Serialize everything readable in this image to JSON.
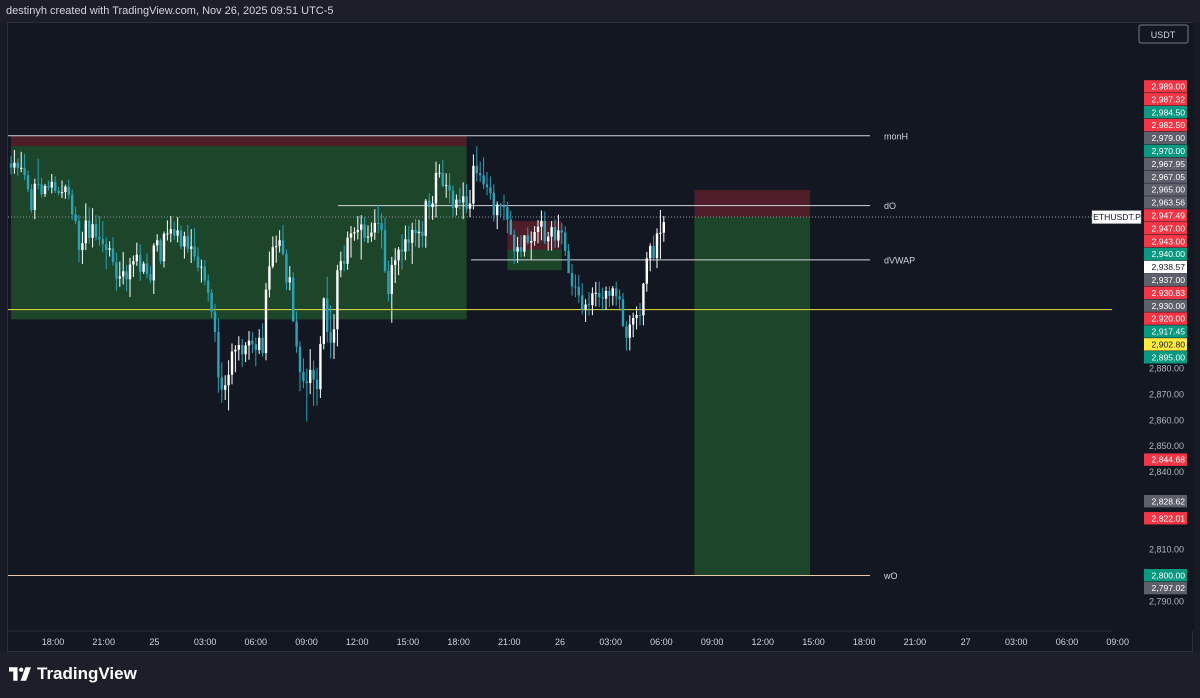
{
  "header": {
    "text": "destinyh created with TradingView.com, Nov 26, 2025 09:51 UTC-5"
  },
  "footer": {
    "brand": "TradingView",
    "logo_icon": "tradingview-logo-icon"
  },
  "colors": {
    "background": "#131722",
    "bull_candle": "#ffffff",
    "bear_candle": "#26a5b8",
    "profit_zone": "#1f4d2b",
    "loss_zone": "#5a1e28",
    "label_red": "#f23645",
    "label_green": "#089981",
    "label_gray": "#5d606b",
    "label_yellow": "#ffeb3b",
    "yellow_line": "#e8e23a",
    "white_line": "#d1d4dc",
    "wo_line": "#e8c9a8",
    "grid_text": "#b2b5be"
  },
  "chart_data": {
    "type": "candlestick",
    "symbol": "ETHUSDT.P",
    "last_price": "2,938.57",
    "currency": "USDT",
    "ylim": [
      2782,
      3002
    ],
    "x_ticks": [
      "18:00",
      "21:00",
      "25",
      "03:00",
      "06:00",
      "09:00",
      "12:00",
      "15:00",
      "18:00",
      "21:00",
      "26",
      "03:00",
      "06:00",
      "09:00",
      "12:00",
      "15:00",
      "18:00",
      "21:00",
      "27",
      "03:00",
      "06:00",
      "09:00"
    ],
    "y_ticks": [
      "2,790.00",
      "2,810.00",
      "2,840.00",
      "2,850.00",
      "2,860.00",
      "2,870.00",
      "2,880.00",
      "2,890.00"
    ],
    "price_labels": [
      {
        "text": "2,989.00",
        "style": "red"
      },
      {
        "text": "2,987.32",
        "style": "red"
      },
      {
        "text": "2,984.50",
        "style": "green"
      },
      {
        "text": "2,982.50",
        "style": "red"
      },
      {
        "text": "2,979.00",
        "style": "gray"
      },
      {
        "text": "2,970.00",
        "style": "green"
      },
      {
        "text": "2,967.95",
        "style": "gray"
      },
      {
        "text": "2,967.05",
        "style": "gray"
      },
      {
        "text": "2,965.00",
        "style": "gray"
      },
      {
        "text": "2,963.56",
        "style": "gray"
      },
      {
        "text": "2,947.49",
        "style": "red"
      },
      {
        "text": "2,947.00",
        "style": "red"
      },
      {
        "text": "2,943.00",
        "style": "red"
      },
      {
        "text": "2,940.00",
        "style": "green"
      },
      {
        "text": "2,938.57",
        "style": "white"
      },
      {
        "text": "2,937.00",
        "style": "gray"
      },
      {
        "text": "2,930.83",
        "style": "red"
      },
      {
        "text": "2,930.00",
        "style": "gray"
      },
      {
        "text": "2,920.00",
        "style": "red"
      },
      {
        "text": "2,917.45",
        "style": "green"
      },
      {
        "text": "2,902.80",
        "style": "yellow"
      },
      {
        "text": "2,895.00",
        "style": "green"
      },
      {
        "text": "2,844.68",
        "style": "red"
      },
      {
        "text": "2,828.62",
        "style": "gray"
      },
      {
        "text": "2,822.01",
        "style": "red"
      },
      {
        "text": "2,800.00",
        "style": "green"
      },
      {
        "text": "2,797.02",
        "style": "gray"
      }
    ],
    "levels": [
      {
        "name": "monH",
        "price": 2970.0,
        "style": "white"
      },
      {
        "name": "dO",
        "price": 2943.0,
        "style": "white"
      },
      {
        "name": "dVWAP",
        "price": 2922.0,
        "style": "white"
      },
      {
        "name": "",
        "price": 2902.8,
        "style": "yellow"
      },
      {
        "name": "wO",
        "price": 2800.0,
        "style": "wo"
      }
    ],
    "candles": [
      [
        2959.3,
        2962.2,
        2955.0,
        2957.7
      ],
      [
        2957.7,
        2964.5,
        2955.3,
        2959.6
      ],
      [
        2959.6,
        2961.3,
        2954.5,
        2957.6
      ],
      [
        2957.6,
        2963.8,
        2955.9,
        2957.6
      ],
      [
        2957.6,
        2963.0,
        2952.8,
        2954.8
      ],
      [
        2954.8,
        2956.5,
        2948.3,
        2949.3
      ],
      [
        2949.3,
        2951.3,
        2940.3,
        2941.3
      ],
      [
        2941.3,
        2953.4,
        2937.7,
        2951.4
      ],
      [
        2951.4,
        2961.1,
        2949.2,
        2951.2
      ],
      [
        2951.2,
        2953.7,
        2946.1,
        2947.5
      ],
      [
        2947.5,
        2951.4,
        2946.3,
        2950.6
      ],
      [
        2950.6,
        2952.7,
        2948.7,
        2950.0
      ],
      [
        2950.0,
        2955.2,
        2947.7,
        2952.2
      ],
      [
        2952.2,
        2954.3,
        2947.9,
        2948.7
      ],
      [
        2948.7,
        2950.2,
        2946.9,
        2947.9
      ],
      [
        2947.9,
        2952.7,
        2946.0,
        2948.2
      ],
      [
        2948.2,
        2951.1,
        2945.6,
        2950.3
      ],
      [
        2950.3,
        2953.1,
        2945.4,
        2947.2
      ],
      [
        2947.2,
        2949.3,
        2937.4,
        2939.6
      ],
      [
        2939.6,
        2942.6,
        2935.8,
        2937.0
      ],
      [
        2937.0,
        2939.4,
        2921.1,
        2925.8
      ],
      [
        2925.8,
        2932.9,
        2920.4,
        2928.5
      ],
      [
        2928.5,
        2943.9,
        2925.8,
        2937.2
      ],
      [
        2937.2,
        2942.3,
        2928.3,
        2930.5
      ],
      [
        2930.5,
        2942.0,
        2926.8,
        2935.8
      ],
      [
        2935.8,
        2939.3,
        2929.5,
        2930.9
      ],
      [
        2930.9,
        2939.0,
        2927.4,
        2930.0
      ],
      [
        2930.0,
        2937.0,
        2924.9,
        2928.1
      ],
      [
        2928.1,
        2930.7,
        2918.4,
        2925.9
      ],
      [
        2925.9,
        2929.2,
        2923.3,
        2926.5
      ],
      [
        2926.5,
        2930.8,
        2919.8,
        2921.1
      ],
      [
        2921.1,
        2924.8,
        2910.0,
        2914.8
      ],
      [
        2914.8,
        2921.3,
        2911.6,
        2915.6
      ],
      [
        2915.6,
        2925.1,
        2912.5,
        2917.6
      ],
      [
        2917.6,
        2920.1,
        2909.8,
        2914.5
      ],
      [
        2914.5,
        2922.8,
        2907.6,
        2920.2
      ],
      [
        2920.2,
        2923.7,
        2915.4,
        2921.5
      ],
      [
        2921.5,
        2928.7,
        2919.7,
        2924.0
      ],
      [
        2924.0,
        2928.1,
        2913.9,
        2917.4
      ],
      [
        2917.4,
        2921.4,
        2916.6,
        2920.6
      ],
      [
        2920.6,
        2924.5,
        2914.9,
        2916.5
      ],
      [
        2916.5,
        2919.7,
        2912.9,
        2914.1
      ],
      [
        2914.1,
        2928.5,
        2908.8,
        2927.6
      ],
      [
        2927.6,
        2931.9,
        2925.2,
        2929.6
      ],
      [
        2929.6,
        2930.3,
        2920.4,
        2921.5
      ],
      [
        2921.5,
        2933.0,
        2919.1,
        2932.1
      ],
      [
        2932.1,
        2937.3,
        2929.5,
        2932.2
      ],
      [
        2932.2,
        2939.0,
        2928.8,
        2933.9
      ],
      [
        2933.9,
        2936.9,
        2929.6,
        2931.4
      ],
      [
        2931.4,
        2938.5,
        2928.8,
        2933.4
      ],
      [
        2933.4,
        2935.3,
        2926.2,
        2927.2
      ],
      [
        2927.2,
        2932.9,
        2922.5,
        2931.2
      ],
      [
        2931.2,
        2935.6,
        2924.7,
        2926.3
      ],
      [
        2926.3,
        2933.9,
        2920.8,
        2927.2
      ],
      [
        2927.2,
        2934.3,
        2921.6,
        2923.3
      ],
      [
        2923.3,
        2926.9,
        2917.5,
        2919.0
      ],
      [
        2919.0,
        2922.1,
        2913.3,
        2919.4
      ],
      [
        2919.4,
        2921.9,
        2912.2,
        2914.0
      ],
      [
        2914.0,
        2916.4,
        2905.9,
        2909.3
      ],
      [
        2909.3,
        2910.7,
        2899.5,
        2902.0
      ],
      [
        2902.0,
        2904.9,
        2890.3,
        2894.1
      ],
      [
        2894.1,
        2899.4,
        2870.7,
        2876.6
      ],
      [
        2876.6,
        2882.4,
        2866.7,
        2871.8
      ],
      [
        2871.8,
        2877.4,
        2867.8,
        2873.5
      ],
      [
        2873.5,
        2883.2,
        2863.8,
        2877.6
      ],
      [
        2877.6,
        2889.7,
        2873.9,
        2886.6
      ],
      [
        2886.6,
        2889.0,
        2878.6,
        2887.3
      ],
      [
        2887.3,
        2892.5,
        2883.1,
        2889.1
      ],
      [
        2889.1,
        2891.5,
        2880.7,
        2885.5
      ],
      [
        2885.5,
        2890.2,
        2882.5,
        2888.9
      ],
      [
        2888.9,
        2894.5,
        2883.4,
        2890.8
      ],
      [
        2890.8,
        2894.2,
        2885.9,
        2889.4
      ],
      [
        2889.4,
        2892.0,
        2880.9,
        2887.2
      ],
      [
        2887.2,
        2895.2,
        2885.6,
        2891.9
      ],
      [
        2891.9,
        2897.5,
        2884.7,
        2886.0
      ],
      [
        2886.0,
        2913.1,
        2883.2,
        2910.5
      ],
      [
        2910.5,
        2925.2,
        2907.5,
        2919.5
      ],
      [
        2919.5,
        2931.1,
        2918.7,
        2926.9
      ],
      [
        2926.9,
        2931.4,
        2920.9,
        2927.4
      ],
      [
        2927.4,
        2933.5,
        2924.9,
        2929.6
      ],
      [
        2929.6,
        2935.5,
        2923.6,
        2924.3
      ],
      [
        2924.3,
        2926.1,
        2910.3,
        2913.3
      ],
      [
        2913.3,
        2919.6,
        2910.2,
        2915.3
      ],
      [
        2915.3,
        2917.2,
        2898.1,
        2898.2
      ],
      [
        2898.2,
        2902.1,
        2886.1,
        2888.5
      ],
      [
        2888.5,
        2890.5,
        2871.2,
        2878.7
      ],
      [
        2878.7,
        2883.9,
        2872.4,
        2875.0
      ],
      [
        2875.0,
        2880.0,
        2859.5,
        2874.4
      ],
      [
        2874.4,
        2887.5,
        2870.1,
        2879.5
      ],
      [
        2879.5,
        2883.1,
        2865.5,
        2875.7
      ],
      [
        2875.7,
        2880.3,
        2865.7,
        2872.0
      ],
      [
        2872.0,
        2892.5,
        2868.6,
        2889.5
      ],
      [
        2889.5,
        2907.5,
        2887.4,
        2907.1
      ],
      [
        2907.1,
        2915.5,
        2890.1,
        2894.1
      ],
      [
        2894.1,
        2904.4,
        2883.9,
        2890.0
      ],
      [
        2890.0,
        2901.0,
        2883.7,
        2895.2
      ],
      [
        2895.2,
        2920.1,
        2888.6,
        2918.0
      ],
      [
        2918.0,
        2925.2,
        2915.3,
        2921.5
      ],
      [
        2921.5,
        2927.7,
        2917.6,
        2920.5
      ],
      [
        2920.5,
        2933.0,
        2918.2,
        2930.6
      ],
      [
        2930.6,
        2935.1,
        2922.9,
        2932.2
      ],
      [
        2932.2,
        2934.6,
        2929.4,
        2932.7
      ],
      [
        2932.7,
        2938.9,
        2929.9,
        2933.6
      ],
      [
        2933.6,
        2939.3,
        2922.1,
        2935.7
      ],
      [
        2935.7,
        2938.5,
        2929.0,
        2930.6
      ],
      [
        2930.6,
        2935.4,
        2928.6,
        2931.0
      ],
      [
        2931.0,
        2936.5,
        2929.0,
        2932.6
      ],
      [
        2932.6,
        2941.6,
        2929.8,
        2936.3
      ],
      [
        2936.3,
        2943.2,
        2932.4,
        2936.2
      ],
      [
        2936.2,
        2940.0,
        2926.4,
        2933.4
      ],
      [
        2933.4,
        2938.4,
        2917.0,
        2917.7
      ],
      [
        2917.7,
        2921.6,
        2905.9,
        2908.8
      ],
      [
        2908.8,
        2923.2,
        2897.7,
        2920.0
      ],
      [
        2920.0,
        2926.5,
        2913.1,
        2921.8
      ],
      [
        2921.8,
        2927.0,
        2916.1,
        2926.0
      ],
      [
        2926.0,
        2931.9,
        2918.3,
        2925.2
      ],
      [
        2925.2,
        2935.3,
        2921.9,
        2930.0
      ],
      [
        2930.0,
        2935.2,
        2925.4,
        2928.6
      ],
      [
        2928.6,
        2936.4,
        2920.4,
        2933.6
      ],
      [
        2933.6,
        2937.9,
        2927.2,
        2932.4
      ],
      [
        2932.4,
        2937.5,
        2926.7,
        2932.9
      ],
      [
        2932.9,
        2937.0,
        2926.9,
        2931.3
      ],
      [
        2931.3,
        2945.6,
        2926.7,
        2944.9
      ],
      [
        2944.9,
        2947.8,
        2937.7,
        2942.4
      ],
      [
        2942.4,
        2946.7,
        2937.5,
        2943.8
      ],
      [
        2943.8,
        2960.0,
        2938.4,
        2955.6
      ],
      [
        2955.6,
        2959.0,
        2953.8,
        2955.7
      ],
      [
        2955.7,
        2960.6,
        2950.1,
        2950.6
      ],
      [
        2950.6,
        2955.5,
        2946.0,
        2950.9
      ],
      [
        2950.9,
        2955.6,
        2943.9,
        2948.8
      ],
      [
        2948.8,
        2950.7,
        2938.7,
        2942.1
      ],
      [
        2942.1,
        2947.3,
        2939.2,
        2945.3
      ],
      [
        2945.3,
        2949.9,
        2941.5,
        2944.2
      ],
      [
        2944.2,
        2952.0,
        2937.8,
        2946.6
      ],
      [
        2946.6,
        2951.2,
        2940.2,
        2941.8
      ],
      [
        2941.8,
        2949.1,
        2938.5,
        2943.8
      ],
      [
        2943.8,
        2962.8,
        2941.5,
        2958.4
      ],
      [
        2958.4,
        2966.0,
        2952.3,
        2955.5
      ],
      [
        2955.5,
        2960.0,
        2952.2,
        2954.7
      ],
      [
        2954.7,
        2961.7,
        2949.4,
        2951.2
      ],
      [
        2951.2,
        2956.0,
        2947.0,
        2950.1
      ],
      [
        2950.1,
        2954.3,
        2945.3,
        2947.9
      ],
      [
        2947.9,
        2951.2,
        2936.8,
        2939.3
      ],
      [
        2939.3,
        2944.6,
        2933.9,
        2943.4
      ],
      [
        2943.4,
        2944.1,
        2938.7,
        2943.0
      ],
      [
        2943.0,
        2947.2,
        2937.3,
        2942.4
      ],
      [
        2942.4,
        2944.5,
        2932.4,
        2937.6
      ],
      [
        2937.6,
        2941.0,
        2931.6,
        2931.8
      ],
      [
        2931.8,
        2933.7,
        2920.4,
        2925.2
      ],
      [
        2925.2,
        2930.9,
        2920.8,
        2926.9
      ],
      [
        2926.9,
        2931.6,
        2923.1,
        2925.2
      ],
      [
        2925.2,
        2931.6,
        2923.3,
        2931.5
      ],
      [
        2931.5,
        2934.6,
        2927.9,
        2928.7
      ],
      [
        2928.7,
        2933.0,
        2922.2,
        2929.3
      ],
      [
        2929.3,
        2935.1,
        2927.5,
        2932.8
      ],
      [
        2932.8,
        2937.4,
        2928.4,
        2934.8
      ],
      [
        2934.8,
        2941.1,
        2929.6,
        2937.1
      ],
      [
        2937.1,
        2940.7,
        2928.1,
        2929.2
      ],
      [
        2929.2,
        2932.8,
        2925.6,
        2931.0
      ],
      [
        2931.0,
        2937.0,
        2925.6,
        2934.7
      ],
      [
        2934.7,
        2937.7,
        2926.7,
        2929.5
      ],
      [
        2929.5,
        2939.5,
        2926.8,
        2933.4
      ],
      [
        2933.4,
        2936.2,
        2928.0,
        2932.6
      ],
      [
        2932.6,
        2935.1,
        2923.5,
        2925.5
      ],
      [
        2925.5,
        2928.1,
        2916.9,
        2916.9
      ],
      [
        2916.9,
        2920.4,
        2908.2,
        2911.8
      ],
      [
        2911.8,
        2916.4,
        2907.6,
        2911.5
      ],
      [
        2911.5,
        2916.2,
        2905.4,
        2908.3
      ],
      [
        2908.3,
        2913.0,
        2900.9,
        2902.8
      ],
      [
        2902.8,
        2906.8,
        2898.0,
        2904.8
      ],
      [
        2904.8,
        2909.6,
        2900.5,
        2904.5
      ],
      [
        2904.5,
        2911.4,
        2900.6,
        2909.1
      ],
      [
        2909.1,
        2913.5,
        2904.0,
        2909.3
      ],
      [
        2909.3,
        2913.7,
        2903.8,
        2907.6
      ],
      [
        2907.6,
        2911.3,
        2902.4,
        2907.0
      ],
      [
        2907.0,
        2911.7,
        2902.8,
        2910.0
      ],
      [
        2910.0,
        2911.8,
        2903.9,
        2908.1
      ],
      [
        2908.1,
        2911.9,
        2904.4,
        2911.0
      ],
      [
        2911.0,
        2913.6,
        2904.3,
        2907.9
      ],
      [
        2907.9,
        2910.6,
        2902.3,
        2906.8
      ],
      [
        2906.8,
        2909.2,
        2896.3,
        2896.3
      ],
      [
        2896.3,
        2898.3,
        2887.0,
        2891.9
      ],
      [
        2891.9,
        2900.6,
        2887.0,
        2897.0
      ],
      [
        2897.0,
        2901.6,
        2892.1,
        2899.5
      ],
      [
        2899.5,
        2904.0,
        2895.1,
        2900.7
      ],
      [
        2900.7,
        2905.3,
        2896.7,
        2900.6
      ],
      [
        2900.6,
        2913.1,
        2896.7,
        2912.8
      ],
      [
        2912.8,
        2925.1,
        2909.7,
        2922.6
      ],
      [
        2922.6,
        2928.4,
        2917.6,
        2927.4
      ],
      [
        2927.4,
        2931.5,
        2921.6,
        2922.7
      ],
      [
        2922.7,
        2934.2,
        2918.8,
        2932.3
      ],
      [
        2932.3,
        2941.3,
        2922.4,
        2932.5
      ],
      [
        2932.5,
        2939.0,
        2929.0,
        2936.6
      ]
    ],
    "annotations": [
      {
        "type": "position",
        "x0": 0,
        "x1": 134,
        "entry": 2966.0,
        "stop": 2970.0,
        "target": 2899.0
      },
      {
        "type": "position",
        "x0": 146,
        "x1": 162,
        "entry": 2926.0,
        "stop": 2937.0,
        "target": 2918.0
      },
      {
        "type": "position",
        "x0": 201,
        "x1": 235,
        "entry": 2938.57,
        "stop": 2949.0,
        "target": 2800.0
      }
    ]
  }
}
